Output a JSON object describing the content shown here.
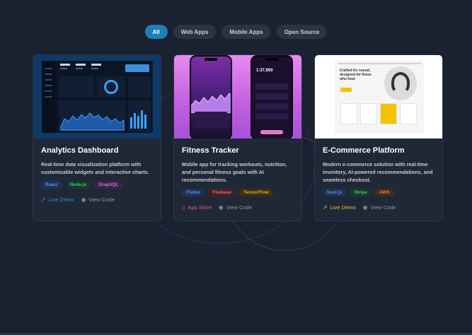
{
  "filters": [
    {
      "label": "All",
      "active": true
    },
    {
      "label": "Web Apps",
      "active": false
    },
    {
      "label": "Mobile Apps",
      "active": false
    },
    {
      "label": "Open Source",
      "active": false
    }
  ],
  "projects": [
    {
      "title": "Analytics Dashboard",
      "description": "Real-time data visualization platform with customizable widgets and interactive charts.",
      "tags": [
        {
          "label": "React",
          "color": "#5b8fd8",
          "bg": "#1e3357"
        },
        {
          "label": "Node.js",
          "color": "#3fc47e",
          "bg": "#17382b"
        },
        {
          "label": "GraphQL",
          "color": "#b77ad9",
          "bg": "#382548"
        }
      ],
      "links": [
        {
          "label": "Live Demo",
          "icon": "external-link-icon",
          "color": "#3b8fd9"
        },
        {
          "label": "View Code",
          "icon": "github-icon",
          "color": "#8d95a3"
        }
      ]
    },
    {
      "title": "Fitness Tracker",
      "description": "Mobile app for tracking workouts, nutrition, and personal fitness goals with AI recommendations.",
      "tags": [
        {
          "label": "Flutter",
          "color": "#5b8fd8",
          "bg": "#1e3357"
        },
        {
          "label": "Firebase",
          "color": "#e06a6a",
          "bg": "#432028"
        },
        {
          "label": "TensorFlow",
          "color": "#e0a23a",
          "bg": "#3d2f18"
        }
      ],
      "links": [
        {
          "label": "App Store",
          "icon": "phone-icon",
          "color": "#e2568f"
        },
        {
          "label": "View Code",
          "icon": "github-icon",
          "color": "#8d95a3"
        }
      ]
    },
    {
      "title": "E-Commerce Platform",
      "description": "Modern e-commerce solution with real-time inventory, AI-powered recommendations, and seamless checkout.",
      "tags": [
        {
          "label": "Next.js",
          "color": "#5b8fd8",
          "bg": "#1e3357"
        },
        {
          "label": "Stripe",
          "color": "#3fc47e",
          "bg": "#17382b"
        },
        {
          "label": "AWS",
          "color": "#e07a4a",
          "bg": "#422a1f"
        }
      ],
      "links": [
        {
          "label": "Live Demo",
          "icon": "external-link-icon",
          "color": "#e8c22a"
        },
        {
          "label": "View Code",
          "icon": "github-icon",
          "color": "#8d95a3"
        }
      ]
    }
  ],
  "mockups": {
    "analytics": {
      "kpis": [
        "3742",
        "12",
        "108"
      ]
    },
    "fitness": {
      "metric": "1:37,900"
    },
    "ecommerce": {
      "headline": "Crafted for sound, designed for those who hear"
    }
  }
}
